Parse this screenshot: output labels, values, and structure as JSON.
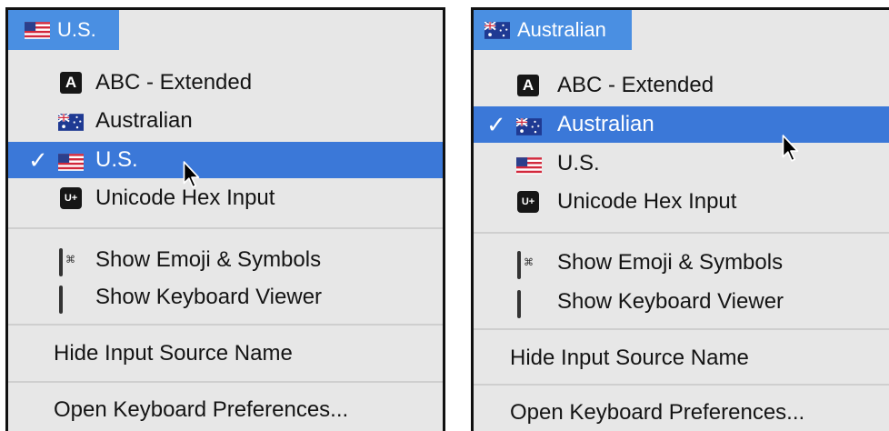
{
  "left_menu": {
    "menubar_label": "U.S.",
    "items": {
      "abc": "ABC - Extended",
      "australian": "Australian",
      "us": "U.S.",
      "unicode": "Unicode Hex Input",
      "emoji": "Show Emoji & Symbols",
      "viewer": "Show Keyboard Viewer",
      "hide_name": "Hide Input Source Name",
      "prefs": "Open Keyboard Preferences..."
    },
    "checked_item": "U.S."
  },
  "right_menu": {
    "menubar_label": "Australian",
    "items": {
      "abc": "ABC - Extended",
      "australian": "Australian",
      "us": "U.S.",
      "unicode": "Unicode Hex Input",
      "emoji": "Show Emoji & Symbols",
      "viewer": "Show Keyboard Viewer",
      "hide_name": "Hide Input Source Name",
      "prefs": "Open Keyboard Preferences..."
    },
    "checked_item": "Australian"
  },
  "glyphs": {
    "checkmark": "✓",
    "abc_icon_letter": "A",
    "unicode_icon_text": "U+",
    "emoji_icon_text": "⌘"
  },
  "colors": {
    "highlight": "#3b78d8",
    "menubar_highlight": "#4a8fe2",
    "menu_background": "#e7e7e7"
  }
}
